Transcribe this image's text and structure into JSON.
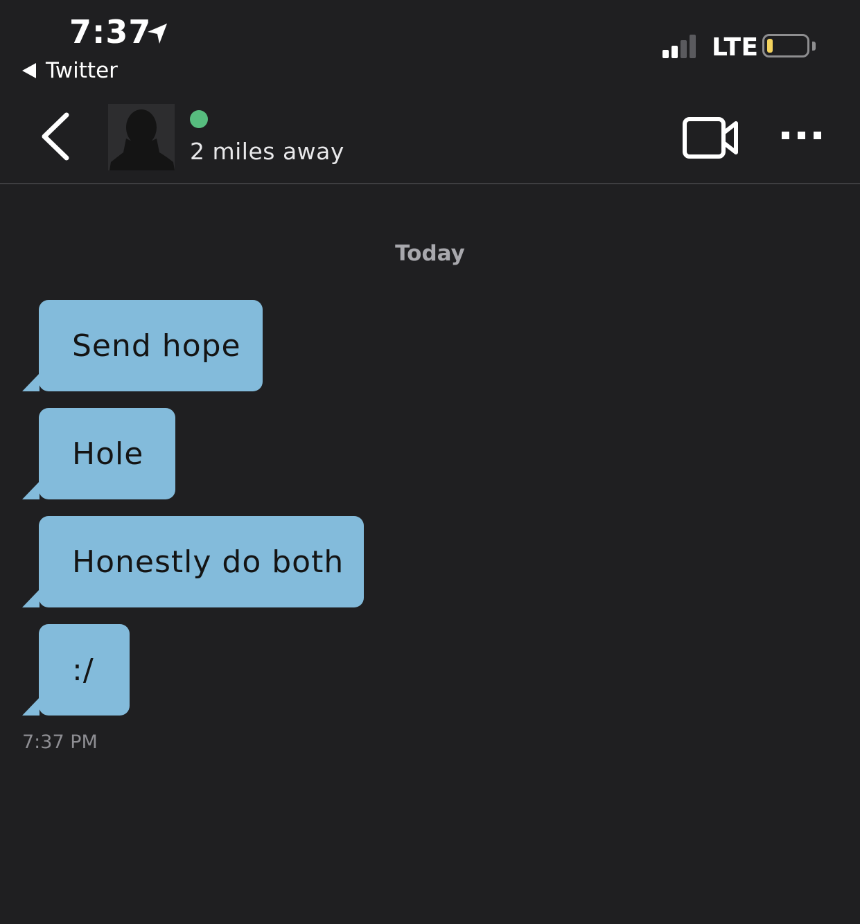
{
  "status_bar": {
    "time": "7:37",
    "back_app": "Twitter",
    "network": "LTE"
  },
  "header": {
    "distance": "2 miles away"
  },
  "conversation": {
    "date_label": "Today",
    "messages": [
      {
        "text": "Send hope"
      },
      {
        "text": "Hole"
      },
      {
        "text": "Honestly do both"
      },
      {
        "text": ":/"
      }
    ],
    "timestamp": "7:37 PM"
  },
  "colors": {
    "background": "#1f1f21",
    "bubble": "#83bbdb",
    "online": "#57bd7f",
    "battery_level": "#f4d35e"
  },
  "icons": [
    "location-arrow-icon",
    "back-triangle-icon",
    "signal-icon",
    "battery-icon",
    "chevron-left-icon",
    "avatar-silhouette-icon",
    "video-camera-icon",
    "more-icon"
  ]
}
